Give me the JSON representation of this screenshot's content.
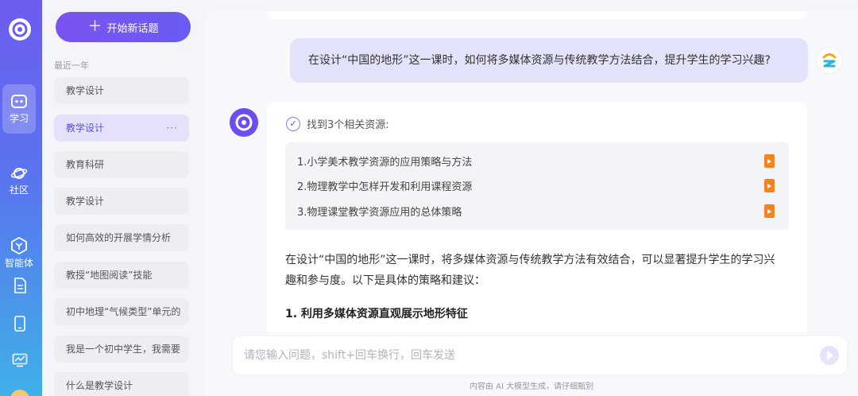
{
  "rail": {
    "items": [
      {
        "label": "学习",
        "icon": "chat-bot-icon"
      },
      {
        "label": "社区",
        "icon": "planet-icon"
      },
      {
        "label": "智能体",
        "icon": "hexagon-agent-icon"
      }
    ],
    "extra_icons": [
      "document-icon",
      "tablet-icon",
      "chart-icon"
    ]
  },
  "sidebar": {
    "new_topic": "开始新话题",
    "section_label": "最近一年",
    "history": [
      "教学设计",
      "教学设计",
      "教育科研",
      "教学设计",
      "如何高效的开展学情分析",
      "教授“地图阅读”技能",
      "初中地理“气候类型”单元的",
      "我是一个初中学生，我需要",
      "什么是教学设计"
    ],
    "more": "···"
  },
  "chat": {
    "user_message": "在设计“中国的地形”这一课时，如何将多媒体资源与传统教学方法结合，提升学生的学习兴趣?",
    "found_label": "找到3个相关资源:",
    "resources": [
      "1.小学美术教学资源的应用策略与方法",
      "2.物理教学中怎样开发和利用课程资源",
      "3.物理课堂教学资源应用的总体策略"
    ],
    "answer_para": "在设计“中国的地形”这一课时，将多媒体资源与传统教学方法有效结合，可以显著提升学生的学习兴趣和参与度。以下是具体的策略和建议：",
    "answer_heading": "1. 利用多媒体资源直观展示地形特征"
  },
  "input": {
    "placeholder": "请您输入问题，shift+回车换行，回车发送",
    "value": ""
  },
  "disclaimer": "内容由 AI 大模型生成，请仔细甄别",
  "colors": {
    "accent": "#6d4df0",
    "user_bubble": "#e2e2fa",
    "file_icon": "#f5841f"
  }
}
